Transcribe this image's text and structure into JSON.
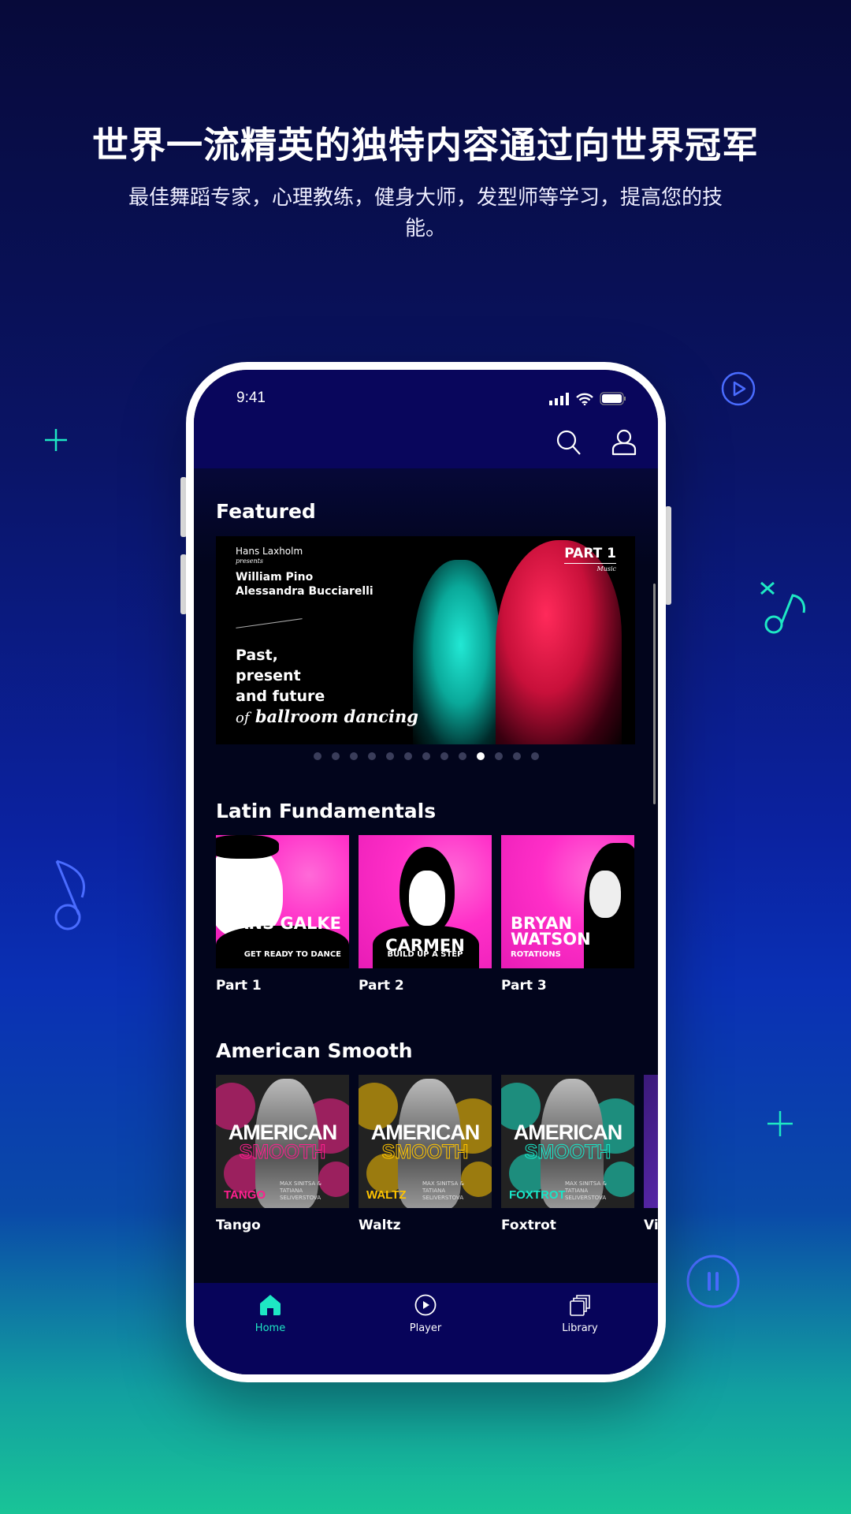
{
  "promo": {
    "headline": "世界一流精英的独特内容通过向世界冠军",
    "subtitle": "最佳舞蹈专家，心理教练，健身大师，发型师等学习，提高您的技能。"
  },
  "status_bar": {
    "time": "9:41"
  },
  "header": {
    "icons": [
      "search-icon",
      "user-icon"
    ]
  },
  "featured": {
    "title": "Featured",
    "banner": {
      "presenter": "Hans Laxholm",
      "presents": "presents",
      "artist1": "William Pino",
      "artist2": "Alessandra Bucciarelli",
      "line1": "Past,",
      "line2": "present",
      "line3": "and future",
      "line4_of": "of",
      "line4": "ballroom dancing",
      "part": "PART 1",
      "part_sub": "Music"
    },
    "dots_total": 13,
    "active_dot": 9
  },
  "latin": {
    "title": "Latin Fundamentals",
    "items": [
      {
        "label": "Part 1",
        "art_name": "HANS GALKE",
        "art_tag": "GET READY TO DANCE"
      },
      {
        "label": "Part 2",
        "art_name": "CARMEN",
        "art_tag": "BUILD UP A STEP"
      },
      {
        "label": "Part 3",
        "art_name": "BRYAN WATSON",
        "art_tag": "ROTATIONS"
      }
    ]
  },
  "american": {
    "title": "American Smooth",
    "art_title": "AMERICAN",
    "art_sub": "SMOOTH",
    "art_credit": "MAX SINITSA & TATIANA SELIVERSTOVA",
    "items": [
      {
        "label": "Tango",
        "dance": "TANGO",
        "color": "#ff1f8f"
      },
      {
        "label": "Waltz",
        "dance": "WALTZ",
        "color": "#ffc400"
      },
      {
        "label": "Foxtrot",
        "dance": "FOXTROT",
        "color": "#19e6c8"
      },
      {
        "label": "Vi",
        "dance": "",
        "color": "#9b4dff"
      }
    ]
  },
  "nav": {
    "items": [
      {
        "label": "Home",
        "icon": "home-icon",
        "active": true
      },
      {
        "label": "Player",
        "icon": "play-circle-icon"
      },
      {
        "label": "Library",
        "icon": "library-icon"
      }
    ]
  },
  "colors": {
    "accent": "#1ee8c4",
    "header": "#09065c",
    "content_bg": "#02051c",
    "pink": "#ff2fc8"
  }
}
